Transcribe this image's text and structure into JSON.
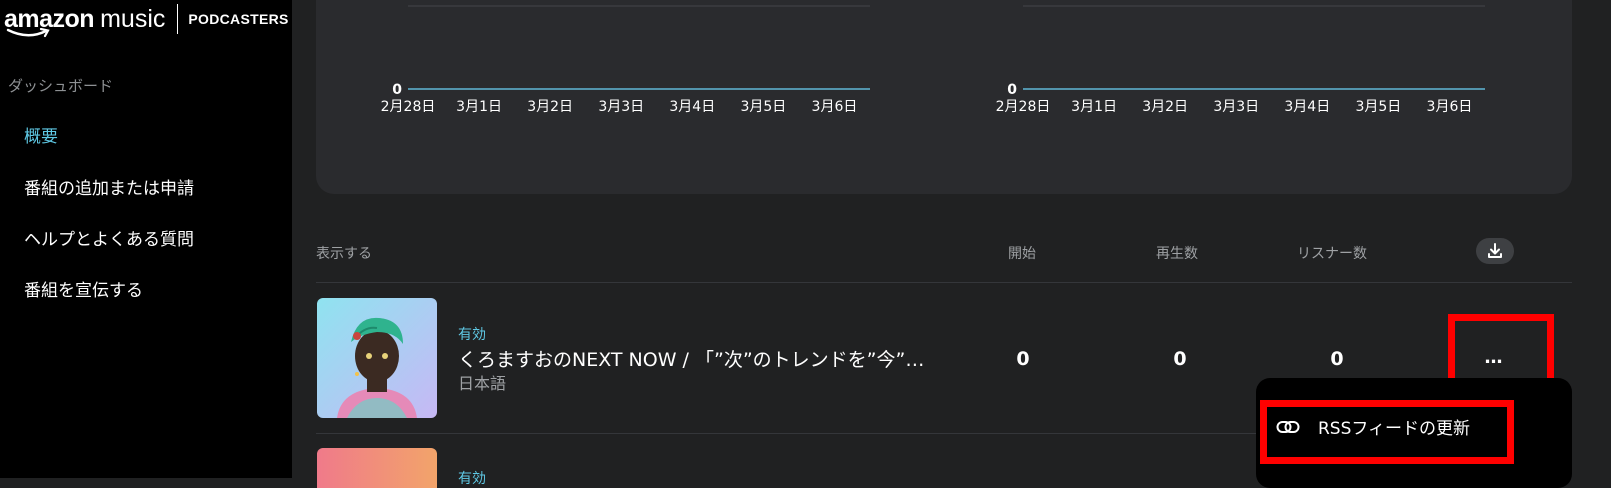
{
  "sidebar": {
    "logo": {
      "amazon": "amazon",
      "music": "music",
      "product": "PODCASTERS"
    },
    "section_label": "ダッシュボード",
    "items": [
      {
        "label": "概要",
        "active": true
      },
      {
        "label": "番組の追加または申請",
        "active": false
      },
      {
        "label": "ヘルプとよくある質問",
        "active": false
      },
      {
        "label": "番組を宣伝する",
        "active": false
      }
    ]
  },
  "chart_data": [
    {
      "type": "line",
      "categories": [
        "2月28日",
        "3月1日",
        "3月2日",
        "3月3日",
        "3月4日",
        "3月5日",
        "3月6日"
      ],
      "series": [
        {
          "values": [
            0,
            0,
            0,
            0,
            0,
            0,
            0
          ]
        }
      ],
      "y_tick_labels": [
        "0"
      ],
      "color": "#5fb8d6"
    },
    {
      "type": "line",
      "categories": [
        "2月28日",
        "3月1日",
        "3月2日",
        "3月3日",
        "3月4日",
        "3月5日",
        "3月6日"
      ],
      "series": [
        {
          "values": [
            0,
            0,
            0,
            0,
            0,
            0,
            0
          ]
        }
      ],
      "y_tick_labels": [
        "0"
      ],
      "color": "#5fb8d6"
    }
  ],
  "table": {
    "headers": {
      "show": "表示する",
      "starts": "開始",
      "plays": "再生数",
      "listeners": "リスナー数"
    },
    "download_icon": "download-icon",
    "rows": [
      {
        "status": "有効",
        "title": "くろますおのNEXT NOW / 「”次”のトレンドを”今”…",
        "language": "日本語",
        "starts": "0",
        "plays": "0",
        "listeners": "0",
        "more": "…"
      },
      {
        "status": "有効"
      }
    ]
  },
  "menu": {
    "items": [
      {
        "label": "RSSフィードの更新",
        "icon": "link-icon"
      }
    ]
  },
  "colors": {
    "accent": "#5fc9e5",
    "highlight": "#ff0000",
    "background": "#202122",
    "card": "#2a2b2e"
  }
}
